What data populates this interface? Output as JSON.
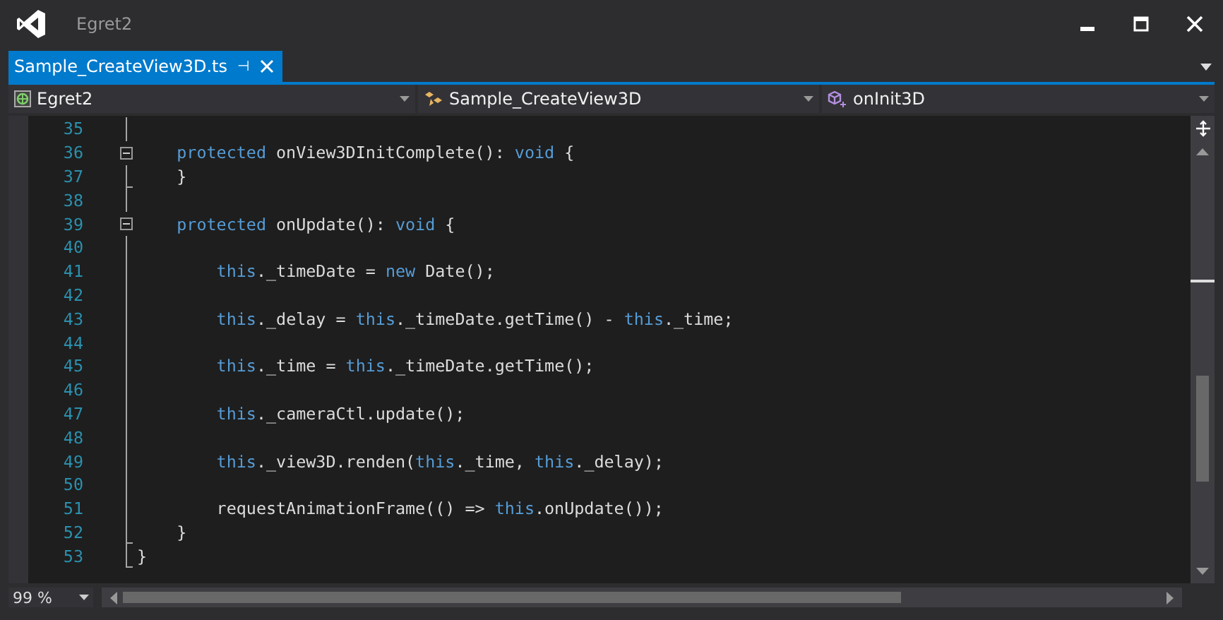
{
  "window": {
    "title": "Egret2"
  },
  "tabs": [
    {
      "label": "Sample_CreateView3D.ts",
      "selected": true,
      "pin": "⊣"
    }
  ],
  "nav_bar": [
    {
      "kind": "project",
      "label": "Egret2"
    },
    {
      "kind": "class",
      "label": "Sample_CreateView3D"
    },
    {
      "kind": "member",
      "label": "onInit3D"
    }
  ],
  "editor": {
    "lines": [
      {
        "number": "35",
        "kind": "fold-line"
      },
      {
        "number": "36",
        "kind": "fold-start",
        "tokens": [
          {
            "kind": "keyword",
            "text": "    protected"
          },
          {
            "kind": "plain",
            "text": " onView3DInitComplete(): "
          },
          {
            "kind": "keyword",
            "text": "void"
          },
          {
            "kind": "plain",
            "text": " {"
          }
        ]
      },
      {
        "number": "37",
        "kind": "fold-end",
        "tokens": [
          {
            "kind": "plain",
            "text": "    }"
          }
        ]
      },
      {
        "number": "38",
        "kind": "fold-line"
      },
      {
        "number": "39",
        "kind": "fold-start",
        "tokens": [
          {
            "kind": "keyword",
            "text": "    protected"
          },
          {
            "kind": "plain",
            "text": " onUpdate(): "
          },
          {
            "kind": "keyword",
            "text": "void"
          },
          {
            "kind": "plain",
            "text": " {"
          }
        ]
      },
      {
        "number": "40",
        "kind": "fold-line"
      },
      {
        "number": "41",
        "kind": "fold-line",
        "tokens": [
          {
            "kind": "keyword",
            "text": "        this"
          },
          {
            "kind": "plain",
            "text": "._timeDate = "
          },
          {
            "kind": "keyword",
            "text": "new"
          },
          {
            "kind": "plain",
            "text": " Date();"
          }
        ]
      },
      {
        "number": "42",
        "kind": "fold-line"
      },
      {
        "number": "43",
        "kind": "fold-line",
        "tokens": [
          {
            "kind": "keyword",
            "text": "        this"
          },
          {
            "kind": "plain",
            "text": "._delay = "
          },
          {
            "kind": "keyword",
            "text": "this"
          },
          {
            "kind": "plain",
            "text": "._timeDate.getTime() - "
          },
          {
            "kind": "keyword",
            "text": "this"
          },
          {
            "kind": "plain",
            "text": "._time;"
          }
        ]
      },
      {
        "number": "44",
        "kind": "fold-line"
      },
      {
        "number": "45",
        "kind": "fold-line",
        "tokens": [
          {
            "kind": "keyword",
            "text": "        this"
          },
          {
            "kind": "plain",
            "text": "._time = "
          },
          {
            "kind": "keyword",
            "text": "this"
          },
          {
            "kind": "plain",
            "text": "._timeDate.getTime();"
          }
        ]
      },
      {
        "number": "46",
        "kind": "fold-line"
      },
      {
        "number": "47",
        "kind": "fold-line",
        "tokens": [
          {
            "kind": "keyword",
            "text": "        this"
          },
          {
            "kind": "plain",
            "text": "._cameraCtl.update();"
          }
        ]
      },
      {
        "number": "48",
        "kind": "fold-line"
      },
      {
        "number": "49",
        "kind": "fold-line",
        "tokens": [
          {
            "kind": "keyword",
            "text": "        this"
          },
          {
            "kind": "plain",
            "text": "._view3D.renden("
          },
          {
            "kind": "keyword",
            "text": "this"
          },
          {
            "kind": "plain",
            "text": "._time, "
          },
          {
            "kind": "keyword",
            "text": "this"
          },
          {
            "kind": "plain",
            "text": "._delay);"
          }
        ]
      },
      {
        "number": "50",
        "kind": "fold-line"
      },
      {
        "number": "51",
        "kind": "fold-line",
        "tokens": [
          {
            "kind": "plain",
            "text": "        requestAnimationFrame(() => "
          },
          {
            "kind": "keyword",
            "text": "this"
          },
          {
            "kind": "plain",
            "text": ".onUpdate());"
          }
        ]
      },
      {
        "number": "52",
        "kind": "fold-end",
        "tokens": [
          {
            "kind": "plain",
            "text": "    }"
          }
        ]
      },
      {
        "number": "53",
        "kind": "fold-end",
        "tokens": [
          {
            "kind": "plain",
            "text": "}"
          }
        ]
      }
    ]
  },
  "zoom": {
    "value": "99 %"
  }
}
